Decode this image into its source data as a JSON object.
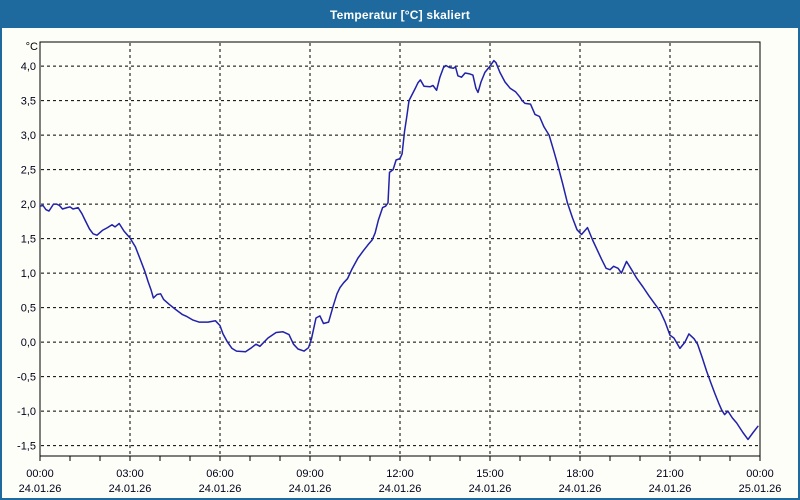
{
  "window": {
    "title": "Temperatur [°C] skaliert",
    "colors": {
      "title_bar": "#1e6a9e",
      "title_text": "#ffffff",
      "border": "#1e6a9e",
      "content_background": "#fdfef7"
    }
  },
  "chart_data": {
    "type": "line",
    "title": "Temperatur [°C] skaliert",
    "ylabel": "°C",
    "xlabel": "",
    "legend_position": "none",
    "grid": {
      "style": "dashed",
      "color": "#000000"
    },
    "frame_color": "#000000",
    "tick_label_color": "#00001a",
    "ylim": [
      -1.65,
      4.35
    ],
    "xlim_hours": [
      0,
      24
    ],
    "minor_xtick_interval_hours": 1,
    "yticks": [
      {
        "value": 4.0,
        "label": "4,0"
      },
      {
        "value": 3.5,
        "label": "3,5"
      },
      {
        "value": 3.0,
        "label": "3,0"
      },
      {
        "value": 2.5,
        "label": "2,5"
      },
      {
        "value": 2.0,
        "label": "2,0"
      },
      {
        "value": 1.5,
        "label": "1,5"
      },
      {
        "value": 1.0,
        "label": "1,0"
      },
      {
        "value": 0.5,
        "label": "0,5"
      },
      {
        "value": 0.0,
        "label": "0,0"
      },
      {
        "value": -0.5,
        "label": "-0,5"
      },
      {
        "value": -1.0,
        "label": "-1,0"
      },
      {
        "value": -1.5,
        "label": "-1,5"
      }
    ],
    "xticks": [
      {
        "hour": 0,
        "time": "00:00",
        "date": "24.01.26"
      },
      {
        "hour": 3,
        "time": "03:00",
        "date": "24.01.26"
      },
      {
        "hour": 6,
        "time": "06:00",
        "date": "24.01.26"
      },
      {
        "hour": 9,
        "time": "09:00",
        "date": "24.01.26"
      },
      {
        "hour": 12,
        "time": "12:00",
        "date": "24.01.26"
      },
      {
        "hour": 15,
        "time": "15:00",
        "date": "24.01.26"
      },
      {
        "hour": 18,
        "time": "18:00",
        "date": "24.01.26"
      },
      {
        "hour": 21,
        "time": "21:00",
        "date": "24.01.26"
      },
      {
        "hour": 24,
        "time": "00:00",
        "date": "25.01.26"
      }
    ],
    "series": [
      {
        "name": "Temperatur",
        "color": "#2121aa",
        "points": [
          [
            0,
            1.97
          ],
          [
            0.1,
            1.98
          ],
          [
            0.2,
            1.92
          ],
          [
            0.3,
            1.9
          ],
          [
            0.45,
            2.0
          ],
          [
            0.55,
            2.0
          ],
          [
            0.65,
            1.98
          ],
          [
            0.75,
            1.93
          ],
          [
            0.9,
            1.95
          ],
          [
            1.0,
            1.96
          ],
          [
            1.1,
            1.93
          ],
          [
            1.27,
            1.95
          ],
          [
            1.4,
            1.86
          ],
          [
            1.5,
            1.77
          ],
          [
            1.65,
            1.64
          ],
          [
            1.77,
            1.57
          ],
          [
            1.9,
            1.55
          ],
          [
            2.08,
            1.62
          ],
          [
            2.25,
            1.66
          ],
          [
            2.4,
            1.7
          ],
          [
            2.5,
            1.67
          ],
          [
            2.64,
            1.72
          ],
          [
            2.8,
            1.61
          ],
          [
            3.0,
            1.51
          ],
          [
            3.18,
            1.38
          ],
          [
            3.35,
            1.19
          ],
          [
            3.5,
            1.02
          ],
          [
            3.6,
            0.88
          ],
          [
            3.7,
            0.76
          ],
          [
            3.78,
            0.64
          ],
          [
            3.9,
            0.69
          ],
          [
            4.02,
            0.7
          ],
          [
            4.12,
            0.62
          ],
          [
            4.3,
            0.55
          ],
          [
            4.5,
            0.48
          ],
          [
            4.75,
            0.4
          ],
          [
            4.9,
            0.37
          ],
          [
            5.1,
            0.32
          ],
          [
            5.3,
            0.29
          ],
          [
            5.6,
            0.29
          ],
          [
            5.85,
            0.31
          ],
          [
            6.0,
            0.24
          ],
          [
            6.1,
            0.12
          ],
          [
            6.25,
            0.0
          ],
          [
            6.4,
            -0.09
          ],
          [
            6.55,
            -0.13
          ],
          [
            6.85,
            -0.14
          ],
          [
            7.05,
            -0.08
          ],
          [
            7.2,
            -0.03
          ],
          [
            7.33,
            -0.06
          ],
          [
            7.6,
            0.06
          ],
          [
            7.87,
            0.14
          ],
          [
            8.1,
            0.15
          ],
          [
            8.3,
            0.11
          ],
          [
            8.45,
            -0.03
          ],
          [
            8.6,
            -0.1
          ],
          [
            8.8,
            -0.13
          ],
          [
            8.95,
            -0.08
          ],
          [
            9.05,
            0.05
          ],
          [
            9.2,
            0.35
          ],
          [
            9.33,
            0.38
          ],
          [
            9.45,
            0.27
          ],
          [
            9.62,
            0.29
          ],
          [
            9.77,
            0.52
          ],
          [
            9.9,
            0.7
          ],
          [
            10.0,
            0.79
          ],
          [
            10.12,
            0.86
          ],
          [
            10.25,
            0.92
          ],
          [
            10.4,
            1.06
          ],
          [
            10.6,
            1.22
          ],
          [
            10.77,
            1.32
          ],
          [
            10.93,
            1.41
          ],
          [
            11.07,
            1.48
          ],
          [
            11.17,
            1.58
          ],
          [
            11.28,
            1.77
          ],
          [
            11.42,
            1.95
          ],
          [
            11.52,
            1.97
          ],
          [
            11.6,
            2.02
          ],
          [
            11.65,
            2.46
          ],
          [
            11.77,
            2.5
          ],
          [
            11.87,
            2.64
          ],
          [
            12.0,
            2.66
          ],
          [
            12.07,
            2.73
          ],
          [
            12.15,
            3.05
          ],
          [
            12.23,
            3.28
          ],
          [
            12.3,
            3.5
          ],
          [
            12.5,
            3.67
          ],
          [
            12.6,
            3.76
          ],
          [
            12.68,
            3.8
          ],
          [
            12.8,
            3.71
          ],
          [
            13.0,
            3.7
          ],
          [
            13.1,
            3.72
          ],
          [
            13.22,
            3.65
          ],
          [
            13.33,
            3.84
          ],
          [
            13.45,
            3.98
          ],
          [
            13.53,
            4.01
          ],
          [
            13.65,
            3.98
          ],
          [
            13.78,
            3.97
          ],
          [
            13.85,
            3.99
          ],
          [
            13.93,
            3.86
          ],
          [
            14.05,
            3.84
          ],
          [
            14.17,
            3.9
          ],
          [
            14.3,
            3.89
          ],
          [
            14.43,
            3.87
          ],
          [
            14.53,
            3.68
          ],
          [
            14.6,
            3.62
          ],
          [
            14.7,
            3.77
          ],
          [
            14.83,
            3.91
          ],
          [
            15.0,
            4.0
          ],
          [
            15.13,
            4.08
          ],
          [
            15.2,
            4.05
          ],
          [
            15.33,
            3.91
          ],
          [
            15.5,
            3.77
          ],
          [
            15.67,
            3.68
          ],
          [
            15.85,
            3.63
          ],
          [
            16.0,
            3.55
          ],
          [
            16.07,
            3.5
          ],
          [
            16.17,
            3.46
          ],
          [
            16.35,
            3.45
          ],
          [
            16.5,
            3.3
          ],
          [
            16.65,
            3.27
          ],
          [
            16.8,
            3.12
          ],
          [
            16.97,
            3.0
          ],
          [
            17.12,
            2.78
          ],
          [
            17.25,
            2.58
          ],
          [
            17.42,
            2.3
          ],
          [
            17.58,
            2.02
          ],
          [
            17.75,
            1.8
          ],
          [
            17.9,
            1.63
          ],
          [
            18.05,
            1.56
          ],
          [
            18.25,
            1.66
          ],
          [
            18.42,
            1.48
          ],
          [
            18.57,
            1.34
          ],
          [
            18.72,
            1.2
          ],
          [
            18.87,
            1.07
          ],
          [
            19.0,
            1.05
          ],
          [
            19.12,
            1.1
          ],
          [
            19.27,
            1.07
          ],
          [
            19.38,
            1.0
          ],
          [
            19.55,
            1.17
          ],
          [
            19.72,
            1.05
          ],
          [
            19.9,
            0.92
          ],
          [
            20.1,
            0.8
          ],
          [
            20.3,
            0.67
          ],
          [
            20.5,
            0.55
          ],
          [
            20.67,
            0.45
          ],
          [
            20.83,
            0.3
          ],
          [
            21.0,
            0.1
          ],
          [
            21.13,
            0.06
          ],
          [
            21.33,
            -0.09
          ],
          [
            21.5,
            0.0
          ],
          [
            21.63,
            0.12
          ],
          [
            21.8,
            0.05
          ],
          [
            21.92,
            -0.03
          ],
          [
            22.07,
            -0.22
          ],
          [
            22.22,
            -0.42
          ],
          [
            22.37,
            -0.6
          ],
          [
            22.5,
            -0.75
          ],
          [
            22.62,
            -0.88
          ],
          [
            22.72,
            -0.98
          ],
          [
            22.82,
            -1.05
          ],
          [
            22.93,
            -1.0
          ],
          [
            23.08,
            -1.1
          ],
          [
            23.22,
            -1.17
          ],
          [
            23.43,
            -1.31
          ],
          [
            23.6,
            -1.41
          ],
          [
            23.77,
            -1.31
          ],
          [
            23.93,
            -1.22
          ]
        ]
      }
    ]
  }
}
